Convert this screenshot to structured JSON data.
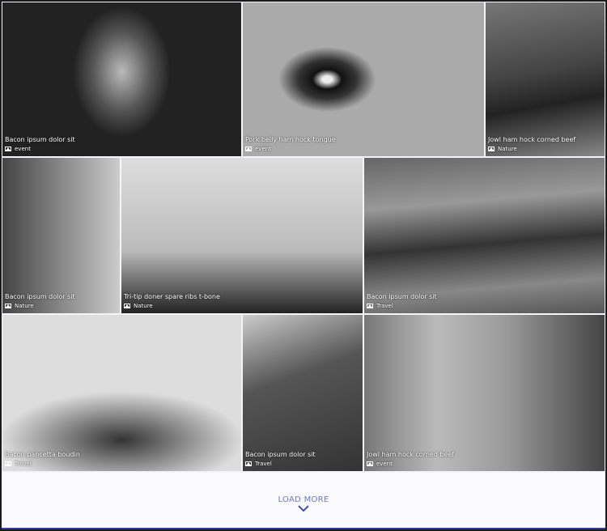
{
  "tiles": [
    {
      "title": "Bacon ipsum dolor sit",
      "category": "event"
    },
    {
      "title": "Pork belly ham hock tongue",
      "category": "event"
    },
    {
      "title": "Jowl ham hock corned beef",
      "category": "Nature"
    },
    {
      "title": "Bacon ipsum dolor sit",
      "category": "Nature"
    },
    {
      "title": "Tri-tip doner spare ribs t-bone",
      "category": "Nature"
    },
    {
      "title": "Bacon ipsum dolor sit",
      "category": "Travel"
    },
    {
      "title": "Bacon pancetta boudin",
      "category": "Travel"
    },
    {
      "title": "Bacon ipsum dolor sit",
      "category": "Travel"
    },
    {
      "title": "Jowl ham hock corned beef",
      "category": "event"
    }
  ],
  "load_more": {
    "label": "LOAD MORE",
    "accent": "#6b76c9"
  }
}
